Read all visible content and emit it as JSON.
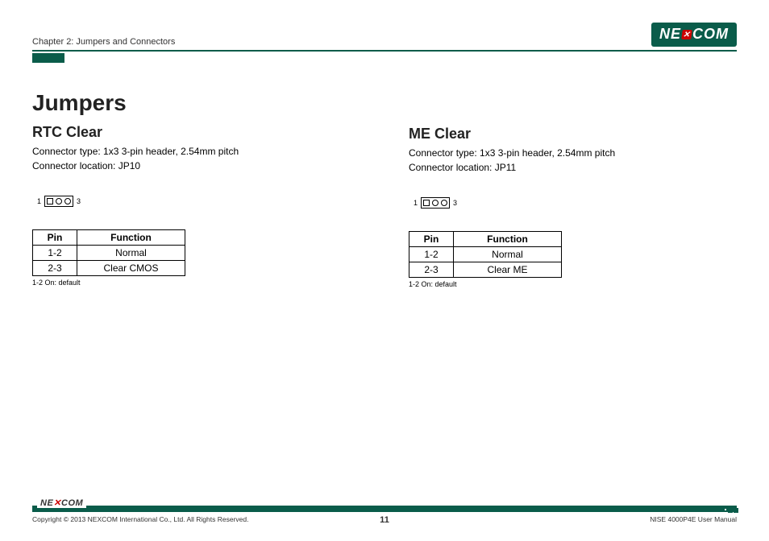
{
  "header": {
    "chapter": "Chapter 2: Jumpers and Connectors",
    "logo_pre": "NE",
    "logo_x": "✕",
    "logo_post": "COM"
  },
  "main": {
    "title": "Jumpers",
    "sections": [
      {
        "heading": "RTC Clear",
        "conn_type": "Connector type: 1x3 3-pin header, 2.54mm pitch",
        "conn_loc": "Connector location: JP10",
        "pin_left": "1",
        "pin_right": "3",
        "table": {
          "head_pin": "Pin",
          "head_func": "Function",
          "rows": [
            {
              "pin": "1-2",
              "func": "Normal"
            },
            {
              "pin": "2-3",
              "func": "Clear CMOS"
            }
          ]
        },
        "note": "1-2 On: default"
      },
      {
        "heading": "ME Clear",
        "conn_type": "Connector type: 1x3 3-pin header, 2.54mm pitch",
        "conn_loc": "Connector location: JP11",
        "pin_left": "1",
        "pin_right": "3",
        "table": {
          "head_pin": "Pin",
          "head_func": "Function",
          "rows": [
            {
              "pin": "1-2",
              "func": "Normal"
            },
            {
              "pin": "2-3",
              "func": "Clear ME"
            }
          ]
        },
        "note": "1-2 On: default"
      }
    ]
  },
  "footer": {
    "logo_pre": "NE",
    "logo_x": "✕",
    "logo_post": "COM",
    "copyright": "Copyright © 2013 NEXCOM International Co., Ltd. All Rights Reserved.",
    "page": "11",
    "manual": "NISE 4000P4E User Manual"
  }
}
